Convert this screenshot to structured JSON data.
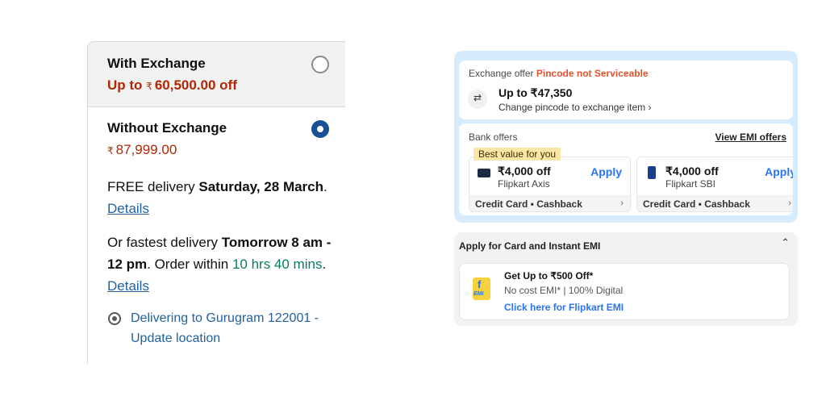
{
  "amazon": {
    "with_exchange": {
      "title": "With Exchange",
      "price_prefix": "Up to",
      "currency": "₹",
      "price": "60,500.00 off"
    },
    "without_exchange": {
      "title": "Without Exchange",
      "currency": "₹",
      "price": "87,999.00"
    },
    "delivery": {
      "prefix": "FREE delivery ",
      "date": "Saturday, 28 March",
      "suffix": ". ",
      "details": "Details"
    },
    "fastest": {
      "prefix": "Or fastest delivery ",
      "when": "Tomorrow 8 am - 12 pm",
      "mid": ". Order within ",
      "countdown": "10 hrs 40 mins",
      "suffix": ". ",
      "details": "Details"
    },
    "location": "Delivering to Gurugram 122001 - Update location"
  },
  "flipkart": {
    "exchange": {
      "label": "Exchange offer",
      "warning": "Pincode not Serviceable",
      "amount": "Up to ₹47,350",
      "change": "Change pincode to exchange item ›"
    },
    "bank": {
      "label": "Bank offers",
      "view_emi": "View EMI offers",
      "badge": "Best value for you",
      "offers": [
        {
          "amount": "₹4,000 off",
          "bank": "Flipkart Axis",
          "apply": "Apply",
          "footer": "Credit Card • Cashback"
        },
        {
          "amount": "₹4,000 off",
          "bank": "Flipkart SBI",
          "apply": "Apply",
          "footer": "Credit Card • Cashback"
        }
      ]
    },
    "emi": {
      "header": "Apply for Card and Instant EMI",
      "line1": "Get Up to ₹500 Off*",
      "line2": "No cost EMI* | 100% Digital",
      "line3": "Click here for Flipkart EMI",
      "logo_text": "f",
      "logo_sub": "EMI"
    }
  }
}
